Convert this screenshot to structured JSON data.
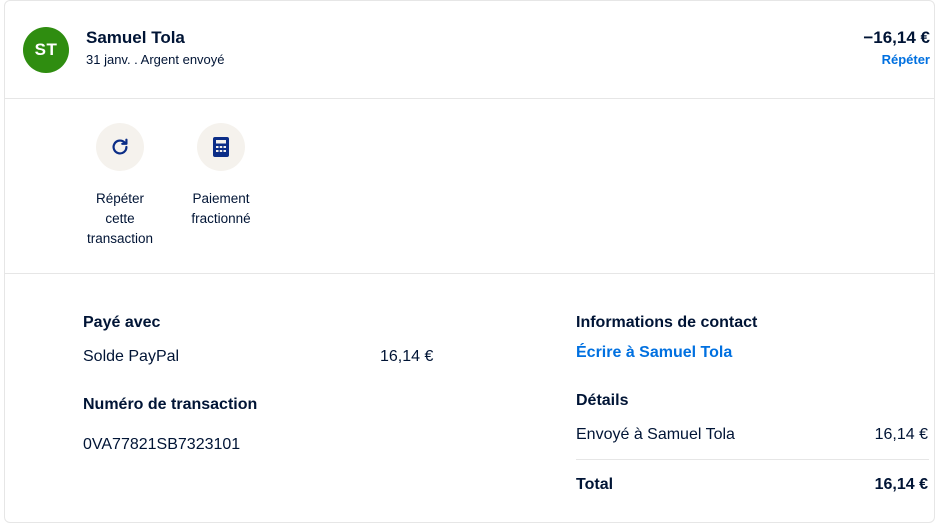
{
  "header": {
    "avatar_initials": "ST",
    "avatar_color": "#2f8d10",
    "name": "Samuel Tola",
    "subtitle": "31 janv. . Argent envoyé",
    "amount": "−16,14 €",
    "repeat_label": "Répéter"
  },
  "actions": [
    {
      "label_lines": [
        "Répéter",
        "cette",
        "transaction"
      ],
      "icon": "refresh-icon"
    },
    {
      "label_lines": [
        "Paiement",
        "fractionné"
      ],
      "icon": "calculator-icon"
    }
  ],
  "payment": {
    "title": "Payé avec",
    "method": "Solde PayPal",
    "amount": "16,14 €"
  },
  "transaction": {
    "title": "Numéro de transaction",
    "id": "0VA77821SB7323101"
  },
  "contact": {
    "title": "Informations de contact",
    "link": "Écrire à Samuel Tola"
  },
  "details": {
    "title": "Détails",
    "sent_label": "Envoyé à Samuel Tola",
    "sent_amount": "16,14 €",
    "total_label": "Total",
    "total_amount": "16,14 €"
  },
  "colors": {
    "text": "#001435",
    "link": "#0070e0",
    "action_bg": "#f5f2ed"
  }
}
